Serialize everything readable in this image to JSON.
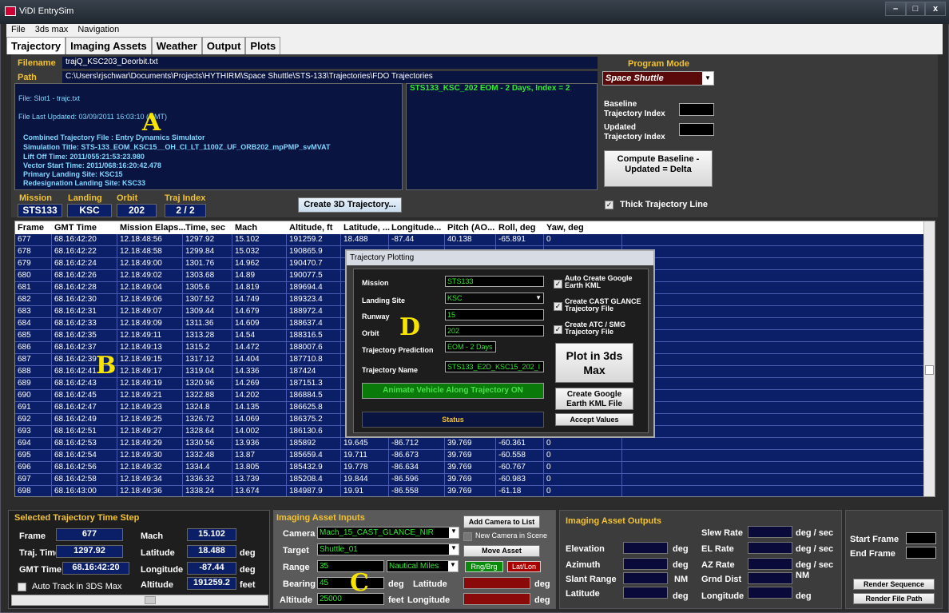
{
  "app": {
    "title": "ViDI EntrySim"
  },
  "menu": [
    "File",
    "3ds max",
    "Navigation"
  ],
  "tabs": [
    "Trajectory",
    "Imaging Assets",
    "Weather",
    "Output",
    "Plots"
  ],
  "file": {
    "filename_label": "Filename",
    "filename": "trajQ_KSC203_Deorbit.txt",
    "path_label": "Path",
    "path": "C:\\Users\\rjschwar\\Documents\\Projects\\HYTHIRM\\Space Shuttle\\STS-133\\Trajectories\\FDO Trajectories"
  },
  "info": {
    "l1": "File: Slot1 - trajc.txt",
    "l2": "File Last Updated: 03/09/2011 16:03:10 (GMT)",
    "l3": "Combined Trajectory File  : Entry Dynamics Simulator",
    "l4": "Simulation Title: STS-133_EOM_KSC15__OH_CI_LT_1100Z_UF_ORB202_mpPMP_svMVAT",
    "l5": "Lift Off Time: 2011/055:21:53:23.980",
    "l6": "Vector Start Time: 2011/068:16:20:42.478",
    "l7": "Primary Landing Site: KSC15",
    "l8": "Redesignation Landing Site: KSC33"
  },
  "green_info": "STS133_KSC_202 EOM - 2 Days, Index = 2",
  "program": {
    "label": "Program Mode",
    "value": "Space Shuttle",
    "baseline_label": "Baseline Trajectory Index",
    "updated_label": "Updated Trajectory Index",
    "compute_label": "Compute Baseline - Updated = Delta",
    "thick_label": "Thick Trajectory Line"
  },
  "mission_bar": {
    "mission_label": "Mission",
    "mission": "STS133",
    "landing_label": "Landing",
    "landing": "KSC",
    "orbit_label": "Orbit",
    "orbit": "202",
    "traj_label": "Traj Index",
    "traj": "2 / 2",
    "create_label": "Create 3D Trajectory..."
  },
  "grid": {
    "headers": [
      "Frame",
      "GMT Time",
      "Mission Elaps...",
      "Time, sec",
      "Mach",
      "Altitude, ft",
      "Latitude, ...",
      "Longitude...",
      "Pitch (AO...",
      "Roll, deg",
      "Yaw, deg"
    ],
    "rows": [
      [
        "677",
        "68.16:42:20",
        "12.18:48:56",
        "1297.92",
        "15.102",
        "191259.2",
        "18.488",
        "-87.44",
        "40.138",
        "-65.891",
        "0"
      ],
      [
        "678",
        "68.16:42:22",
        "12.18:48:58",
        "1299.84",
        "15.032",
        "190865.9",
        "",
        "",
        "",
        "",
        ""
      ],
      [
        "679",
        "68.16:42:24",
        "12.18:49:00",
        "1301.76",
        "14.962",
        "190470.7",
        "",
        "",
        "",
        "",
        ""
      ],
      [
        "680",
        "68.16:42:26",
        "12.18:49:02",
        "1303.68",
        "14.89",
        "190077.5",
        "",
        "",
        "",
        "",
        ""
      ],
      [
        "681",
        "68.16:42:28",
        "12.18:49:04",
        "1305.6",
        "14.819",
        "189694.4",
        "",
        "",
        "",
        "",
        ""
      ],
      [
        "682",
        "68.16:42:30",
        "12.18:49:06",
        "1307.52",
        "14.749",
        "189323.4",
        "",
        "",
        "",
        "",
        ""
      ],
      [
        "683",
        "68.16:42:31",
        "12.18:49:07",
        "1309.44",
        "14.679",
        "188972.4",
        "",
        "",
        "",
        "",
        ""
      ],
      [
        "684",
        "68.16:42:33",
        "12.18:49:09",
        "1311.36",
        "14.609",
        "188637.4",
        "",
        "",
        "",
        "",
        ""
      ],
      [
        "685",
        "68.16:42:35",
        "12.18:49:11",
        "1313.28",
        "14.54",
        "188316.5",
        "",
        "",
        "",
        "",
        ""
      ],
      [
        "686",
        "68.16:42:37",
        "12.18:49:13",
        "1315.2",
        "14.472",
        "188007.6",
        "",
        "",
        "",
        "",
        ""
      ],
      [
        "687",
        "68.16:42:39",
        "12.18:49:15",
        "1317.12",
        "14.404",
        "187710.8",
        "",
        "",
        "",
        "",
        ""
      ],
      [
        "688",
        "68.16:42:41",
        "12.18:49:17",
        "1319.04",
        "14.336",
        "187424",
        "",
        "",
        "",
        "",
        ""
      ],
      [
        "689",
        "68.16:42:43",
        "12.18:49:19",
        "1320.96",
        "14.269",
        "187151.3",
        "",
        "",
        "",
        "",
        ""
      ],
      [
        "690",
        "68.16:42:45",
        "12.18:49:21",
        "1322.88",
        "14.202",
        "186884.5",
        "",
        "",
        "",
        "",
        ""
      ],
      [
        "691",
        "68.16:42:47",
        "12.18:49:23",
        "1324.8",
        "14.135",
        "186625.8",
        "",
        "",
        "",
        "",
        ""
      ],
      [
        "692",
        "68.16:42:49",
        "12.18:49:25",
        "1326.72",
        "14.069",
        "186375.2",
        "",
        "",
        "",
        "",
        ""
      ],
      [
        "693",
        "68.16:42:51",
        "12.18:49:27",
        "1328.64",
        "14.002",
        "186130.6",
        "",
        "",
        "",
        "",
        ""
      ],
      [
        "694",
        "68.16:42:53",
        "12.18:49:29",
        "1330.56",
        "13.936",
        "185892",
        "19.645",
        "-86.712",
        "39.769",
        "-60.361",
        "0"
      ],
      [
        "695",
        "68.16:42:54",
        "12.18:49:30",
        "1332.48",
        "13.87",
        "185659.4",
        "19.711",
        "-86.673",
        "39.769",
        "-60.558",
        "0"
      ],
      [
        "696",
        "68.16:42:56",
        "12.18:49:32",
        "1334.4",
        "13.805",
        "185432.9",
        "19.778",
        "-86.634",
        "39.769",
        "-60.767",
        "0"
      ],
      [
        "697",
        "68.16:42:58",
        "12.18:49:34",
        "1336.32",
        "13.739",
        "185208.4",
        "19.844",
        "-86.596",
        "39.769",
        "-60.983",
        "0"
      ],
      [
        "698",
        "68.16:43:00",
        "12.18:49:36",
        "1338.24",
        "13.674",
        "184987.9",
        "19.91",
        "-86.558",
        "39.769",
        "-61.18",
        "0"
      ]
    ]
  },
  "dialog": {
    "title": "Trajectory Plotting",
    "mission_label": "Mission",
    "mission": "STS133",
    "site_label": "Landing Site",
    "site": "KSC",
    "runway_label": "Runway",
    "runway": "15",
    "orbit_label": "Orbit",
    "orbit": "202",
    "pred_label": "Trajectory Prediction",
    "pred": "EOM - 2 Days",
    "name_label": "Trajectory Name",
    "name": "STS133_E2D_KSC15_202_I",
    "animate": "Animate Vehicle Along Trajectory ON",
    "status": "Status",
    "chk1": "Auto Create Google Earth KML",
    "chk2": "Create CAST GLANCE Trajectory File",
    "chk3": "Create ATC / SMG Trajectory File",
    "plot": "Plot in 3ds Max",
    "kml": "Create Google Earth KML File",
    "accept": "Accept Values"
  },
  "letters": {
    "a": "A",
    "b": "B",
    "c": "C",
    "d": "D"
  },
  "step": {
    "title": "Selected Trajectory Time Step",
    "frame_label": "Frame",
    "frame": "677",
    "traj_label": "Traj. Time",
    "traj": "1297.92",
    "gmt_label": "GMT Time",
    "gmt": "68.16:42:20",
    "mach_label": "Mach",
    "mach": "15.102",
    "lat_label": "Latitude",
    "lat": "18.488",
    "lon_label": "Longitude",
    "lon": "-87.44",
    "alt_label": "Altitude",
    "alt": "191259.2",
    "deg": "deg",
    "feet": "feet",
    "auto": "Auto Track in 3DS Max"
  },
  "inputs": {
    "title": "Imaging Asset Inputs",
    "camera_label": "Camera",
    "camera": "Mach_15_CAST_GLANCE_NIR",
    "target_label": "Target",
    "target": "Shuttle_01",
    "range_label": "Range",
    "range": "35",
    "units": "Nautical Miles",
    "bearing_label": "Bearing",
    "bearing": "45",
    "alt_label": "Altitude",
    "alt": "25000",
    "deg": "deg",
    "feet": "feet",
    "lat_label": "Latitude",
    "lon_label": "Longitude",
    "add": "Add Camera to List",
    "newcam": "New Camera in Scene",
    "move": "Move Asset",
    "rng": "Rng/Brg",
    "latlon": "Lat/Lon"
  },
  "outputs": {
    "title": "Imaging Asset Outputs",
    "elev": "Elevation",
    "az": "Azimuth",
    "slant": "Slant Range",
    "lat": "Latitude",
    "slew": "Slew Rate",
    "el": "EL Rate",
    "azr": "AZ Rate",
    "grnd": "Grnd Dist",
    "lon": "Longitude",
    "deg": "deg",
    "degsec": "deg / sec",
    "nm": "NM"
  },
  "render": {
    "start": "Start Frame",
    "end": "End Frame",
    "seq": "Render Sequence",
    "path": "Render File Path"
  }
}
